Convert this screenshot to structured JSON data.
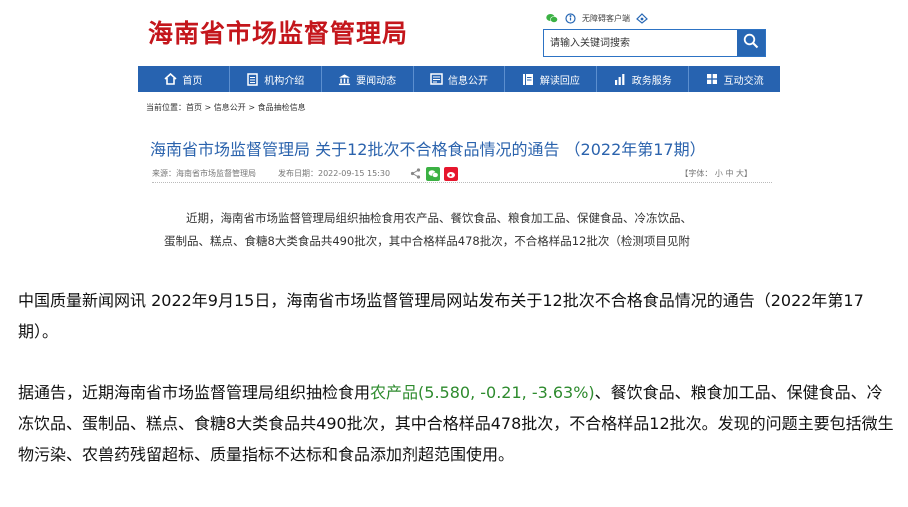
{
  "site": {
    "logo": "海南省市场监督管理局",
    "top_links": {
      "accessible": "无障碍客户端"
    },
    "search": {
      "placeholder": "请输入关键词搜索"
    },
    "nav": [
      {
        "label": "首页",
        "icon": "home-icon"
      },
      {
        "label": "机构介绍",
        "icon": "document-icon"
      },
      {
        "label": "要闻动态",
        "icon": "building-icon"
      },
      {
        "label": "信息公开",
        "icon": "info-icon"
      },
      {
        "label": "解读回应",
        "icon": "book-icon"
      },
      {
        "label": "政务服务",
        "icon": "chart-icon"
      },
      {
        "label": "互动交流",
        "icon": "grid-icon"
      }
    ],
    "breadcrumb": "当前位置：首页 > 信息公开 > 食品抽检信息",
    "article": {
      "title": "海南省市场监督管理局 关于12批次不合格食品情况的通告 （2022年第17期）",
      "source": "来源：海南省市场监督管理局",
      "date": "发布日期：2022-09-15 15:30",
      "font_size": "【字体： 小   中   大】",
      "excerpt_line1": "近期，海南省市场监督管理局组织抽检食用农产品、餐饮食品、粮食加工品、保健食品、冷冻饮品、",
      "excerpt_line2": "蛋制品、糕点、食糖8大类食品共490批次，其中合格样品478批次，不合格样品12批次（检测项目见附"
    }
  },
  "news": {
    "p1": "中国质量新闻网讯 2022年9月15日，海南省市场监督管理局网站发布关于12批次不合格食品情况的通告（2022年第17期）。",
    "p2_a": "据通告，近期海南省市场监督管理局组织抽检食用",
    "p2_link": "农产品",
    "p2_quote": "(5.580, -0.21, -3.63%)",
    "p2_b": "、餐饮食品、粮食加工品、保健食品、冷冻饮品、蛋制品、糕点、食糖8大类食品共490批次，其中合格样品478批次，不合格样品12批次。发现的问题主要包括微生物污染、农兽药残留超标、质量指标不达标和食品添加剂超范围使用。"
  },
  "colors": {
    "brand_red": "#c4161c",
    "nav_blue": "#2763b0",
    "title_blue": "#2b63ad",
    "quote_green": "#2e8b2e"
  }
}
